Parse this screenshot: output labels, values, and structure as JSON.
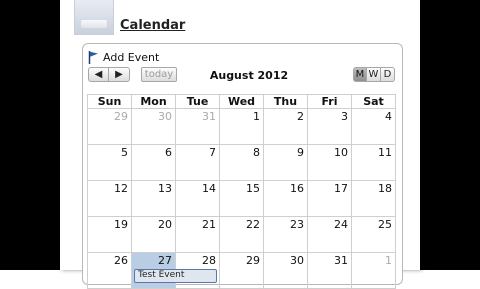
{
  "page": {
    "title": "Calendar"
  },
  "toolbar": {
    "add_event_label": "Add Event",
    "prev_label": "◀",
    "next_label": "▶",
    "today_label": "today",
    "month_title": "August 2012",
    "view_month": "M",
    "view_week": "W",
    "view_day": "D"
  },
  "weekdays": [
    "Sun",
    "Mon",
    "Tue",
    "Wed",
    "Thu",
    "Fri",
    "Sat"
  ],
  "weeks": [
    [
      {
        "d": "29",
        "other": true
      },
      {
        "d": "30",
        "other": true
      },
      {
        "d": "31",
        "other": true
      },
      {
        "d": "1"
      },
      {
        "d": "2"
      },
      {
        "d": "3"
      },
      {
        "d": "4"
      }
    ],
    [
      {
        "d": "5"
      },
      {
        "d": "6"
      },
      {
        "d": "7"
      },
      {
        "d": "8"
      },
      {
        "d": "9"
      },
      {
        "d": "10"
      },
      {
        "d": "11"
      }
    ],
    [
      {
        "d": "12"
      },
      {
        "d": "13"
      },
      {
        "d": "14"
      },
      {
        "d": "15"
      },
      {
        "d": "16"
      },
      {
        "d": "17"
      },
      {
        "d": "18"
      }
    ],
    [
      {
        "d": "19"
      },
      {
        "d": "20"
      },
      {
        "d": "21"
      },
      {
        "d": "22"
      },
      {
        "d": "23"
      },
      {
        "d": "24"
      },
      {
        "d": "25"
      }
    ],
    [
      {
        "d": "26"
      },
      {
        "d": "27",
        "today": true
      },
      {
        "d": "28"
      },
      {
        "d": "29"
      },
      {
        "d": "30"
      },
      {
        "d": "31"
      },
      {
        "d": "1",
        "other": true
      }
    ]
  ],
  "event": {
    "label": "Test Event",
    "day": "27"
  },
  "colors": {
    "today_bg": "#b9cde5",
    "event_border": "#5b78a5",
    "event_bg": "#dfe6ef",
    "other_month_text": "#aaaaaa"
  }
}
